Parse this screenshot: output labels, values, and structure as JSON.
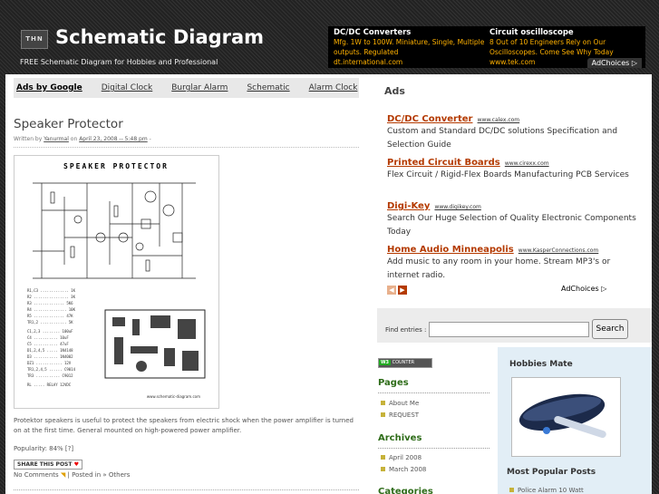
{
  "header": {
    "logo_badge": "THN",
    "title": "Schematic Diagram",
    "tagline": "FREE Schematic Diagram for Hobbies and Professional",
    "ad": {
      "col1_title": "DC/DC Converters",
      "col1_text": "Mfg. 1W to 100W. Miniature, Single, Multiple outputs. Regulated",
      "col1_url": "dt.international.com",
      "col2_title": "Circuit oscilloscope",
      "col2_text": "8 Out of 10 Engineers Rely on Our Oscilloscopes. Come See Why Today",
      "col2_url": "www.tek.com",
      "adchoices": "AdChoices ▷"
    }
  },
  "adlinks": [
    "Ads by Google",
    "Digital Clock",
    "Burglar Alarm",
    "Schematic",
    "Alarm Clock"
  ],
  "post": {
    "title": "Speaker Protector",
    "byline_prefix": "Written by",
    "author": "Yanurmal",
    "byline_on": "on",
    "date": "April 23, 2008 -- 5:48 pm",
    "byline_suffix": "-",
    "image_title": "SPEAKER PROTECTOR",
    "image_credit": "www.schematic-diagram.com",
    "description": "Protektor speakers is useful to protect the speakers from electric shock when the power amplifier is turned on at the first time. General mounted on high-powered power amplifier.",
    "popularity": "Popularity: 84% [?]",
    "share_label": "SHARE THIS POST",
    "comments": "No Comments",
    "posted_in_prefix": "| Posted in",
    "category": "Others"
  },
  "sidebar": {
    "ads_heading": "Ads",
    "ads": [
      {
        "title": "DC/DC Converter",
        "domain": "www.calex.com",
        "text": "Custom and Standard DC/DC solutions Specification and Selection Guide"
      },
      {
        "title": "Printed Circuit Boards",
        "domain": "www.cirexx.com",
        "text": "Flex Circuit / Rigid-Flex Boards Manufacturing PCB Services"
      },
      {
        "title": "Digi-Key",
        "domain": "www.digikey.com",
        "text": "Search Our Huge Selection of Quality Electronic Components Today"
      },
      {
        "title": "Home Audio Minneapolis",
        "domain": "www.KasperConnections.com",
        "text": "Add music to any room in your home. Stream MP3's or internet radio."
      }
    ],
    "adchoices": "AdChoices ▷",
    "search_label": "Find entries :",
    "search_button": "Search",
    "counter": "COUNTER",
    "counter_badge": "W3",
    "pages_heading": "Pages",
    "pages": [
      "About Me",
      "REQUEST"
    ],
    "archives_heading": "Archives",
    "archives": [
      "April 2008",
      "March 2008"
    ],
    "categories_heading": "Categories",
    "hobbies_heading": "Hobbies Mate",
    "popular_heading": "Most Popular Posts",
    "popular": [
      "Police Alarm 10 Watt"
    ]
  },
  "colors": {
    "accent": "#2f6d1a",
    "ad_link": "#b43a00",
    "header_ad_text": "#ffb100"
  }
}
